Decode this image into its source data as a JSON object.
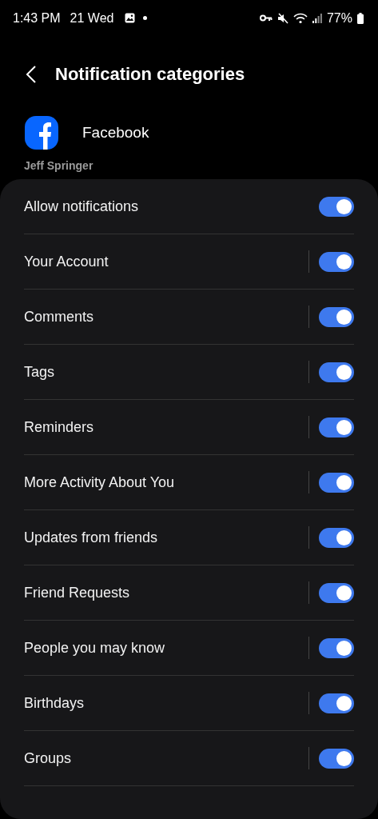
{
  "status_bar": {
    "time": "1:43 PM",
    "date": "21 Wed",
    "battery": "77%"
  },
  "header": {
    "title": "Notification categories"
  },
  "app": {
    "name": "Facebook"
  },
  "account": "Jeff Springer",
  "items": [
    {
      "label": "Allow notifications",
      "kind": "master",
      "on": true
    },
    {
      "label": "Your Account",
      "kind": "category",
      "on": true
    },
    {
      "label": "Comments",
      "kind": "category",
      "on": true
    },
    {
      "label": "Tags",
      "kind": "category",
      "on": true
    },
    {
      "label": "Reminders",
      "kind": "category",
      "on": true
    },
    {
      "label": "More Activity About You",
      "kind": "category",
      "on": true
    },
    {
      "label": "Updates from friends",
      "kind": "category",
      "on": true
    },
    {
      "label": "Friend Requests",
      "kind": "category",
      "on": true
    },
    {
      "label": "People you may know",
      "kind": "category",
      "on": true
    },
    {
      "label": "Birthdays",
      "kind": "category",
      "on": true
    },
    {
      "label": "Groups",
      "kind": "category",
      "on": true
    }
  ]
}
